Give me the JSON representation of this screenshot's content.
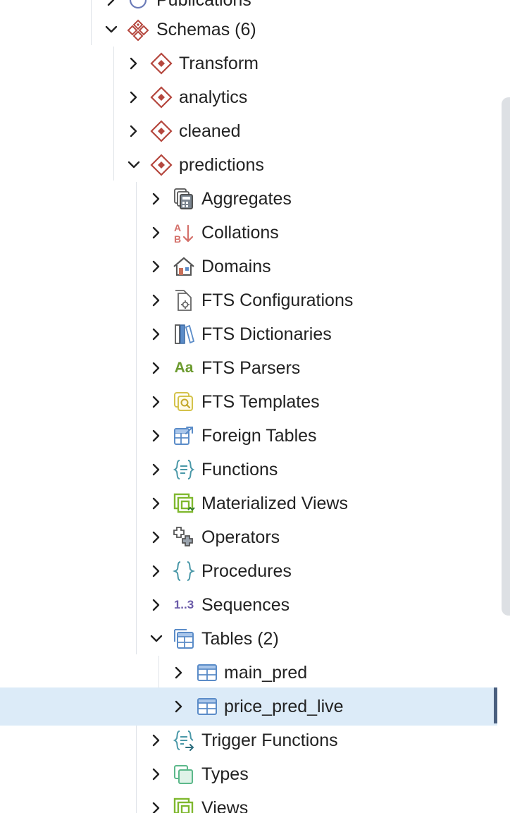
{
  "tree": {
    "publications": {
      "label": "Publications"
    },
    "schemas": {
      "label": "Schemas",
      "count": "(6)"
    },
    "schema_items": [
      {
        "label": "Transform"
      },
      {
        "label": "analytics"
      },
      {
        "label": "cleaned"
      },
      {
        "label": "predictions"
      }
    ],
    "predictions_children": {
      "aggregates": "Aggregates",
      "collations": "Collations",
      "domains": "Domains",
      "fts_configurations": "FTS Configurations",
      "fts_dictionaries": "FTS Dictionaries",
      "fts_parsers": "FTS Parsers",
      "fts_templates": "FTS Templates",
      "foreign_tables": "Foreign Tables",
      "functions": "Functions",
      "materialized_views": "Materialized Views",
      "operators": "Operators",
      "procedures": "Procedures",
      "sequences": "Sequences",
      "tables": "Tables",
      "tables_count": "(2)",
      "trigger_functions": "Trigger Functions",
      "types": "Types",
      "views": "Views"
    },
    "tables": [
      {
        "label": "main_pred"
      },
      {
        "label": "price_pred_live"
      }
    ],
    "icon_glyphs": {
      "fts_parsers": "Aa",
      "sequences": "1..3"
    }
  },
  "colors": {
    "selection_bg": "#dcebf8",
    "selection_bar": "#4a5f7f",
    "schema_icon": "#b5473e",
    "guide_line": "#dfe3e8"
  }
}
